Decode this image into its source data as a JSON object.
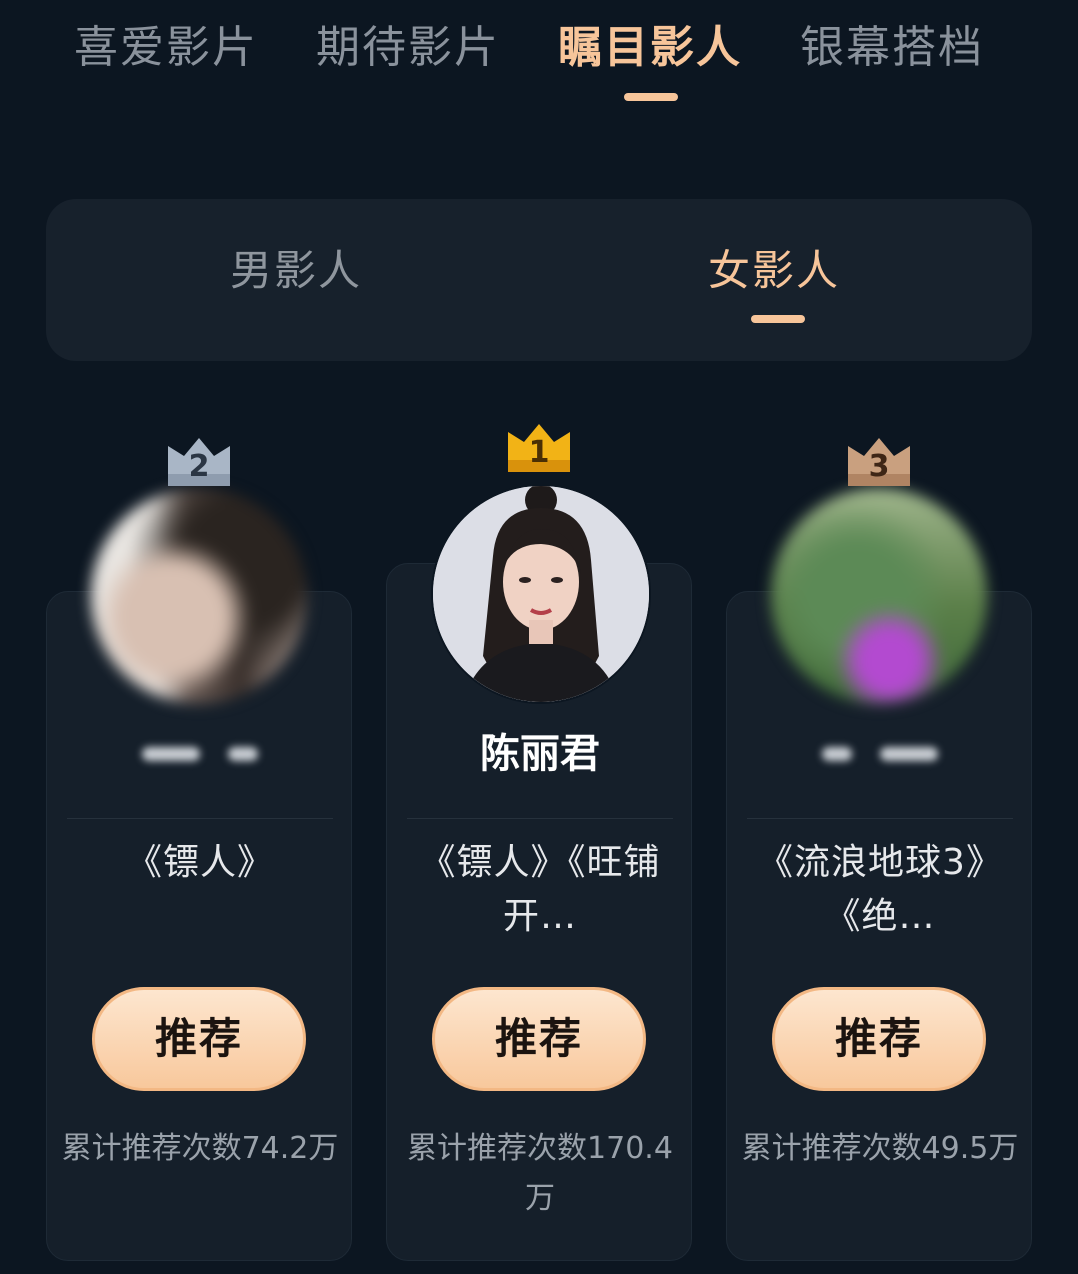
{
  "top_tabs": [
    {
      "label": "喜爱影片",
      "active": false
    },
    {
      "label": "期待影片",
      "active": false
    },
    {
      "label": "瞩目影人",
      "active": true
    },
    {
      "label": "银幕搭档",
      "active": false
    }
  ],
  "gender_tabs": [
    {
      "label": "男影人",
      "active": false
    },
    {
      "label": "女影人",
      "active": true
    }
  ],
  "ranking": [
    {
      "rank": "2",
      "name": "",
      "name_masked": true,
      "works": "《镖人》",
      "button": "推荐",
      "count": "累计推荐次数74.2万",
      "crown_color": "#a9b6c6"
    },
    {
      "rank": "1",
      "name": "陈丽君",
      "name_masked": false,
      "works": "《镖人》《旺铺开…",
      "button": "推荐",
      "count": "累计推荐次数170.4万",
      "crown_color": "#f2b316"
    },
    {
      "rank": "3",
      "name": "",
      "name_masked": true,
      "works": "《流浪地球3》《绝…",
      "button": "推荐",
      "count": "累计推荐次数49.5万",
      "crown_color": "#c9a07f"
    }
  ],
  "colors": {
    "background": "#0c1621",
    "accent": "#f7c59a",
    "card": "#151f2a",
    "button_gradient_top": "#fde6cf",
    "button_gradient_bottom": "#f8c89c"
  }
}
